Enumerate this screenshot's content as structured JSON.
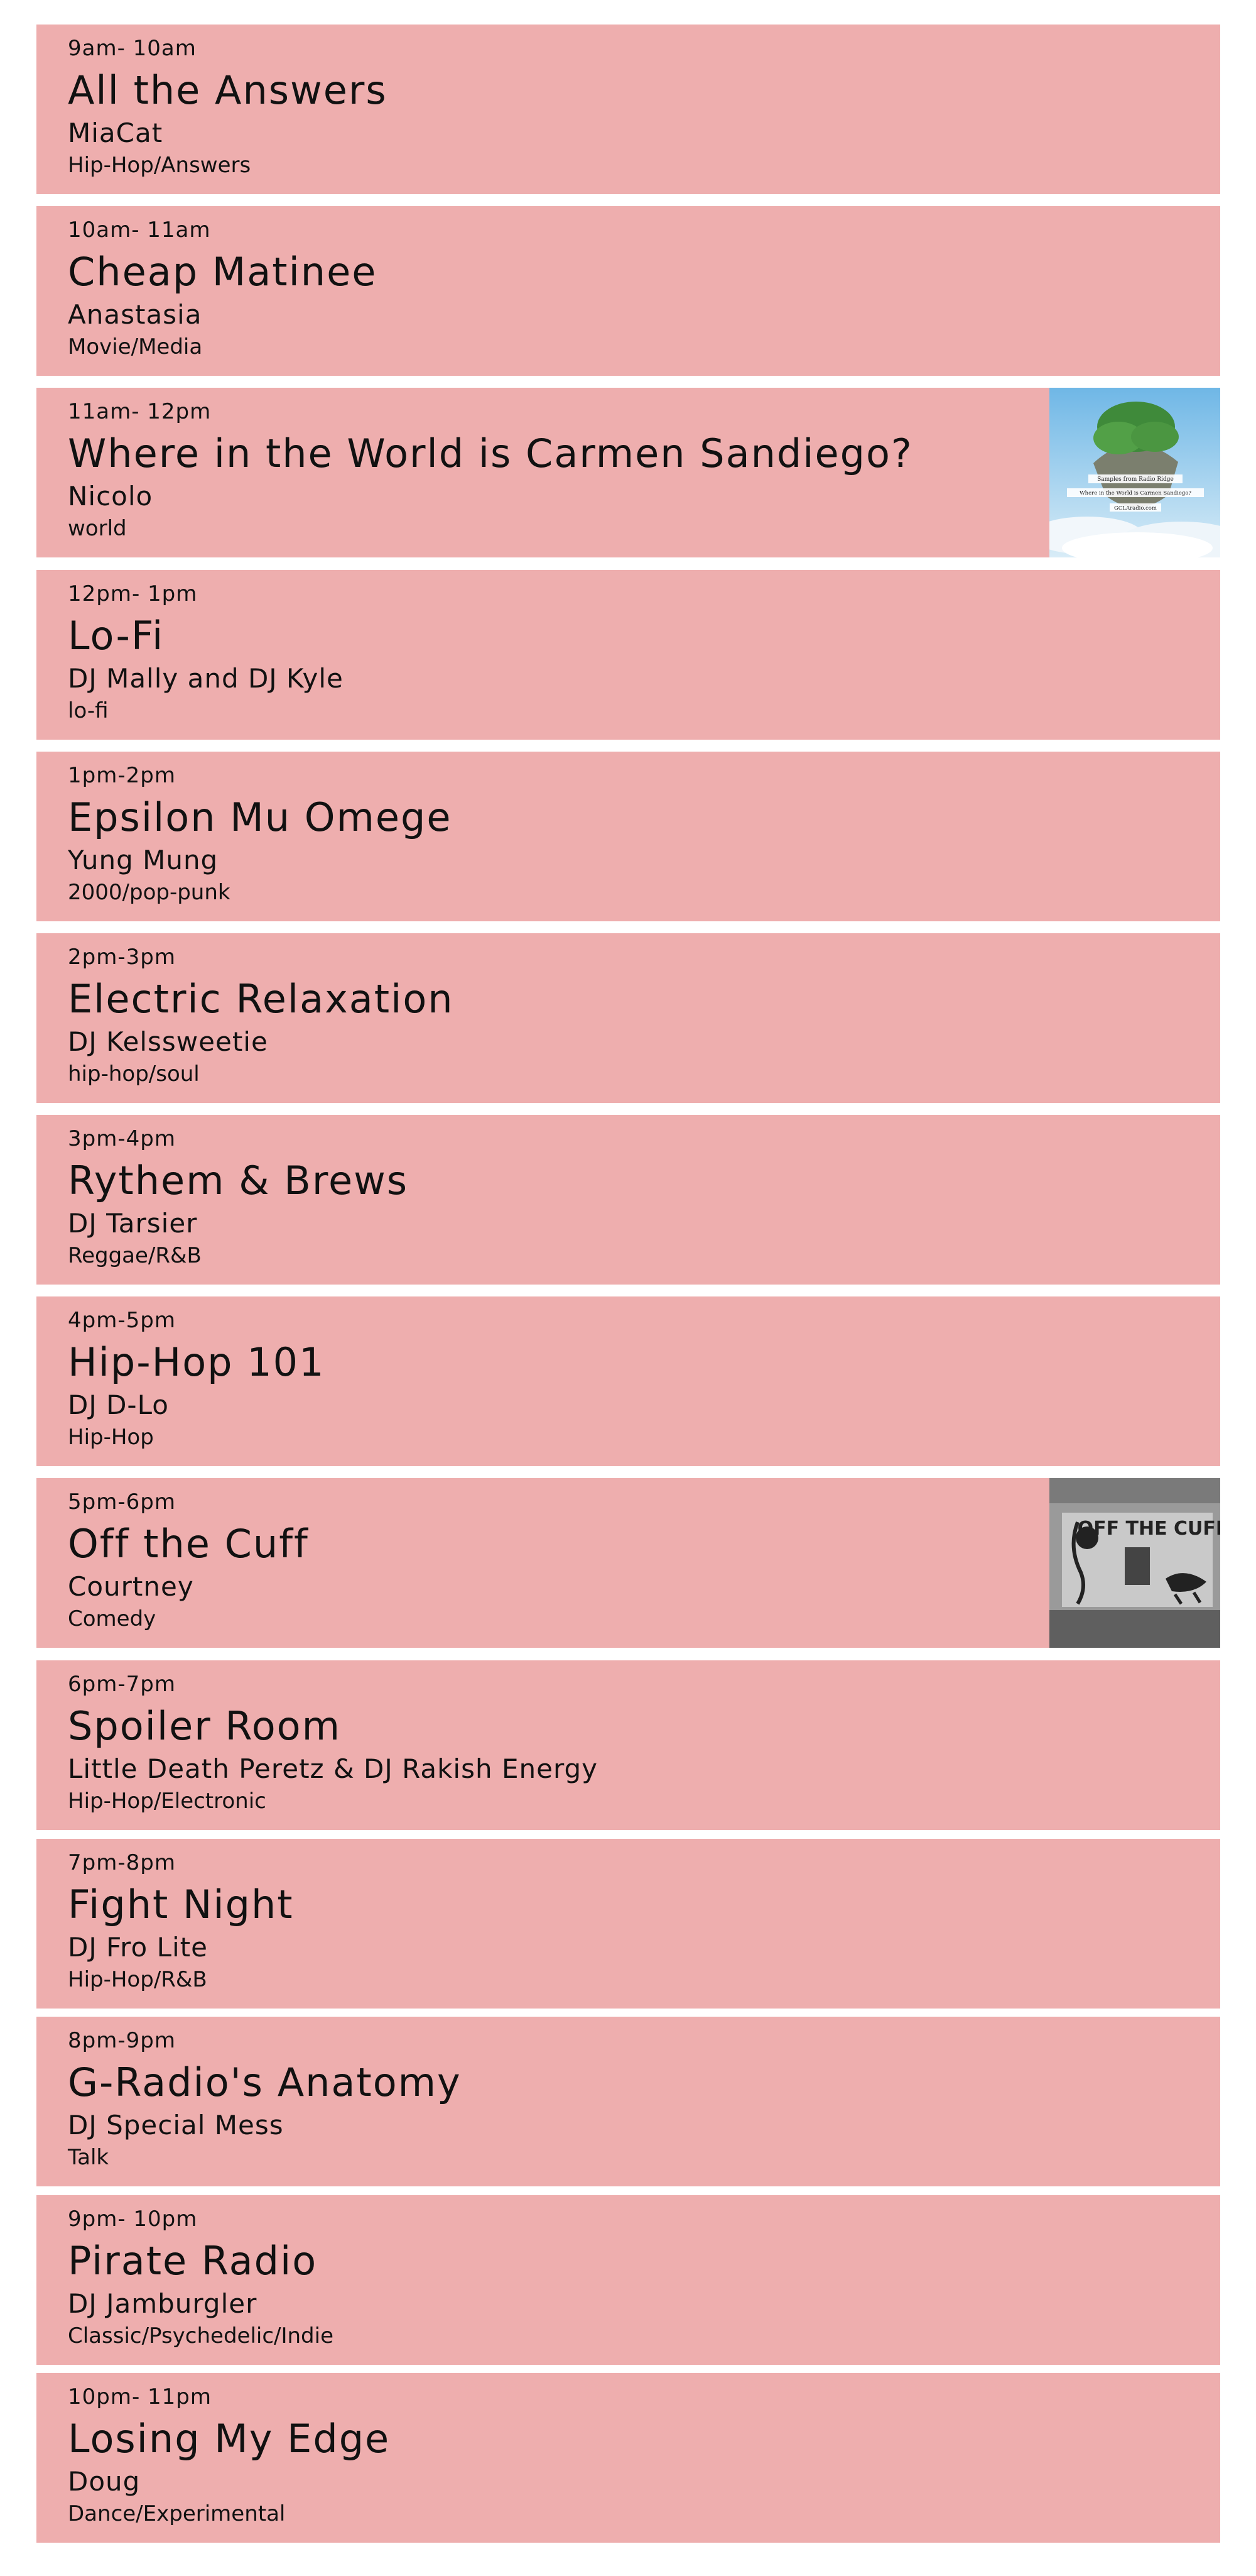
{
  "colors": {
    "card_background": "#eeaeae",
    "page_background": "#ffffff",
    "text": "#111111"
  },
  "shows": [
    {
      "time": "9am- 10am",
      "title": "All the Answers",
      "host": "MiaCat",
      "genre": "Hip-Hop/Answers"
    },
    {
      "time": "10am- 11am",
      "title": "Cheap Matinee",
      "host": "Anastasia",
      "genre": "Movie/Media"
    },
    {
      "time": "11am- 12pm",
      "title": "Where in the World is Carmen Sandiego?",
      "host": "Nicolo",
      "genre": "world",
      "thumbnail": {
        "icon": "floating-island-image",
        "lines": [
          "Samples from Radio Ridge",
          "Where in the World is Carmen Sandiego?",
          "GCLAradio.com"
        ]
      }
    },
    {
      "time": "12pm- 1pm",
      "title": "Lo-Fi",
      "host": "DJ Mally and DJ Kyle",
      "genre": "lo-fi"
    },
    {
      "time": "1pm-2pm",
      "title": "Epsilon Mu Omege",
      "host": "Yung Mung",
      "genre": "2000/pop-punk"
    },
    {
      "time": "2pm-3pm",
      "title": "Electric Relaxation",
      "host": "DJ Kelssweetie",
      "genre": "hip-hop/soul"
    },
    {
      "time": "3pm-4pm",
      "title": "Rythem & Brews",
      "host": "DJ Tarsier",
      "genre": "Reggae/R&B"
    },
    {
      "time": "4pm-5pm",
      "title": "Hip-Hop 101",
      "host": "DJ D-Lo",
      "genre": "Hip-Hop"
    },
    {
      "time": "5pm-6pm",
      "title": "Off the Cuff",
      "host": "Courtney",
      "genre": "Comedy",
      "thumbnail": {
        "icon": "off-the-cuff-photo",
        "lines": [
          "OFF THE CUFF"
        ]
      }
    },
    {
      "time": "6pm-7pm",
      "title": "Spoiler Room",
      "host": "Little Death Peretz & DJ Rakish Energy",
      "genre": "Hip-Hop/Electronic"
    },
    {
      "time": "7pm-8pm",
      "title": "Fight Night",
      "host": "DJ Fro Lite",
      "genre": "Hip-Hop/R&B"
    },
    {
      "time": "8pm-9pm",
      "title": "G-Radio's Anatomy",
      "host": "DJ Special Mess",
      "genre": "Talk"
    },
    {
      "time": "9pm- 10pm",
      "title": "Pirate Radio",
      "host": "DJ Jamburgler",
      "genre": "Classic/Psychedelic/Indie"
    },
    {
      "time": "10pm- 11pm",
      "title": "Losing My Edge",
      "host": "Doug",
      "genre": "Dance/Experimental"
    }
  ]
}
